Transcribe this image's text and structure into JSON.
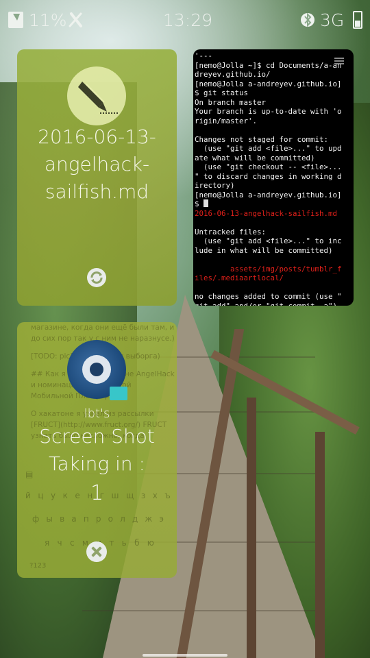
{
  "status_bar": {
    "battery_percent": "11%",
    "time": "13:29",
    "network": "3G"
  },
  "editor_card": {
    "title": "2016-06-13-angelhack-sailfish.md",
    "title_lines": [
      "2016-06-13-",
      "angelhack-",
      "sailfish.md"
    ]
  },
  "terminal_card": {
    "lines": [
      {
        "text": "'---",
        "color": "white"
      },
      {
        "text": "[nemo@Jolla ~]$ cd Documents/a-an",
        "color": "white"
      },
      {
        "text": "dreyev.github.io/",
        "color": "white"
      },
      {
        "text": "[nemo@Jolla a-andreyev.github.io]",
        "color": "white"
      },
      {
        "text": "$ git status",
        "color": "white"
      },
      {
        "text": "On branch master",
        "color": "white"
      },
      {
        "text": "Your branch is up-to-date with 'o",
        "color": "white"
      },
      {
        "text": "rigin/master'.",
        "color": "white"
      },
      {
        "text": "",
        "color": "white"
      },
      {
        "text": "Changes not staged for commit:",
        "color": "white"
      },
      {
        "text": "  (use \"git add <file>...\" to upd",
        "color": "white"
      },
      {
        "text": "ate what will be committed)",
        "color": "white"
      },
      {
        "text": "  (use \"git checkout -- <file>...",
        "color": "white"
      },
      {
        "text": "\" to discard changes in working d",
        "color": "white"
      },
      {
        "text": "irectory)",
        "color": "white"
      },
      {
        "text": "[nemo@Jolla a-andreyev.github.io]",
        "color": "white"
      },
      {
        "text": "$ ",
        "color": "white",
        "cursor": true
      },
      {
        "text": "2016-06-13-angelhack-sailfish.md",
        "color": "red"
      },
      {
        "text": "",
        "color": "white"
      },
      {
        "text": "Untracked files:",
        "color": "white"
      },
      {
        "text": "  (use \"git add <file>...\" to inc",
        "color": "white"
      },
      {
        "text": "lude in what will be committed)",
        "color": "white"
      },
      {
        "text": "",
        "color": "white"
      },
      {
        "text": "        assets/img/posts/tumblr_f",
        "color": "red"
      },
      {
        "text": "iles/.mediaartlocal/",
        "color": "red"
      },
      {
        "text": "",
        "color": "white"
      },
      {
        "text": "no changes added to commit (use \"",
        "color": "white"
      },
      {
        "text": "git add\" and/or \"git commit -a\")",
        "color": "white"
      }
    ]
  },
  "screenshot_card": {
    "app_name": "lbt's",
    "line1": "Screen Shot",
    "line2": "Taking in :",
    "countdown": "1",
    "background_note": [
      "магазине, когда они ещё были там, и до сих пор так у с ним не наразнусе.)",
      "[TODO: pic](#картинка с выборга)",
      "## Как я узнал о хакатоне AngelHack и номинации от Открытой Мобильной Платформы",
      "О хакатоне я узнал из рассылки [FRUCT](http://www.fruct.org/) FRUCT узнать было несложно, когда"
    ],
    "keyboard_rows": [
      [
        "й",
        "ц",
        "у",
        "к",
        "е",
        "н",
        "г",
        "ш",
        "щ",
        "з",
        "х",
        "ъ"
      ],
      [
        "ф",
        "ы",
        "в",
        "а",
        "п",
        "р",
        "о",
        "л",
        "д",
        "ж",
        "э"
      ],
      [
        "я",
        "ч",
        "с",
        "м",
        "и",
        "т",
        "ь",
        "б",
        "ю"
      ]
    ],
    "keyboard_bottom": "?123"
  }
}
